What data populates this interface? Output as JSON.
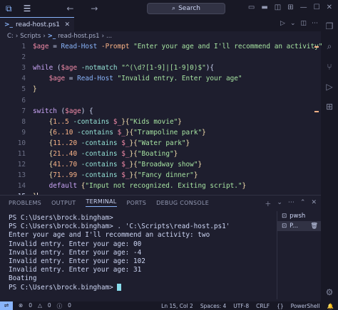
{
  "titlebar": {
    "search_placeholder": "Search"
  },
  "tab": {
    "filename": "read-host.ps1",
    "breadcrumb": [
      "C:",
      "Scripts",
      "read-host.ps1",
      "..."
    ]
  },
  "code": [
    {
      "n": "1",
      "tokens": [
        [
          "var",
          "$age"
        ],
        [
          "pl",
          " = "
        ],
        [
          "cmd",
          "Read-Host"
        ],
        [
          "par",
          " -Prompt "
        ],
        [
          "str",
          "\"Enter your age and I'll recommend an activity\""
        ]
      ]
    },
    {
      "n": "2",
      "tokens": []
    },
    {
      "n": "3",
      "tokens": [
        [
          "kw",
          "while"
        ],
        [
          "pl",
          " ("
        ],
        [
          "var",
          "$age"
        ],
        [
          "op",
          " -notmatch "
        ],
        [
          "str",
          "\"^(\\d?[1-9]|[1-9]0)$\""
        ],
        [
          "pl",
          "){"
        ]
      ]
    },
    {
      "n": "4",
      "tokens": [
        [
          "pl",
          "    "
        ],
        [
          "var",
          "$age"
        ],
        [
          "pl",
          " = "
        ],
        [
          "cmd",
          "Read-Host"
        ],
        [
          "str",
          " \"Invalid entry. Enter your age\""
        ]
      ]
    },
    {
      "n": "5",
      "tokens": [
        [
          "br",
          "}"
        ]
      ]
    },
    {
      "n": "6",
      "tokens": []
    },
    {
      "n": "7",
      "tokens": [
        [
          "kw",
          "switch"
        ],
        [
          "pl",
          " ("
        ],
        [
          "var",
          "$age"
        ],
        [
          "pl",
          ") {"
        ]
      ]
    },
    {
      "n": "8",
      "tokens": [
        [
          "pl",
          "    "
        ],
        [
          "br",
          "{"
        ],
        [
          "par",
          "1..5"
        ],
        [
          "op",
          " -contains "
        ],
        [
          "var",
          "$_"
        ],
        [
          "br",
          "}"
        ],
        [
          "br",
          "{"
        ],
        [
          "str",
          "\"Kids movie\""
        ],
        [
          "br",
          "}"
        ]
      ]
    },
    {
      "n": "9",
      "tokens": [
        [
          "pl",
          "    "
        ],
        [
          "br",
          "{"
        ],
        [
          "par",
          "6..10"
        ],
        [
          "op",
          " -contains "
        ],
        [
          "var",
          "$_"
        ],
        [
          "br",
          "}"
        ],
        [
          "br",
          "{"
        ],
        [
          "str",
          "\"Trampoline park\""
        ],
        [
          "br",
          "}"
        ]
      ]
    },
    {
      "n": "10",
      "tokens": [
        [
          "pl",
          "    "
        ],
        [
          "br",
          "{"
        ],
        [
          "par",
          "11..20"
        ],
        [
          "op",
          " -contains "
        ],
        [
          "var",
          "$_"
        ],
        [
          "br",
          "}"
        ],
        [
          "br",
          "{"
        ],
        [
          "str",
          "\"Water park\""
        ],
        [
          "br",
          "}"
        ]
      ]
    },
    {
      "n": "11",
      "tokens": [
        [
          "pl",
          "    "
        ],
        [
          "br",
          "{"
        ],
        [
          "par",
          "21..40"
        ],
        [
          "op",
          " -contains "
        ],
        [
          "var",
          "$_"
        ],
        [
          "br",
          "}"
        ],
        [
          "br",
          "{"
        ],
        [
          "str",
          "\"Boating\""
        ],
        [
          "br",
          "}"
        ]
      ]
    },
    {
      "n": "12",
      "tokens": [
        [
          "pl",
          "    "
        ],
        [
          "br",
          "{"
        ],
        [
          "par",
          "41..70"
        ],
        [
          "op",
          " -contains "
        ],
        [
          "var",
          "$_"
        ],
        [
          "br",
          "}"
        ],
        [
          "br",
          "{"
        ],
        [
          "str",
          "\"Broadway show\""
        ],
        [
          "br",
          "}"
        ]
      ]
    },
    {
      "n": "13",
      "tokens": [
        [
          "pl",
          "    "
        ],
        [
          "br",
          "{"
        ],
        [
          "par",
          "71..99"
        ],
        [
          "op",
          " -contains "
        ],
        [
          "var",
          "$_"
        ],
        [
          "br",
          "}"
        ],
        [
          "br",
          "{"
        ],
        [
          "str",
          "\"Fancy dinner\""
        ],
        [
          "br",
          "}"
        ]
      ]
    },
    {
      "n": "14",
      "tokens": [
        [
          "pl",
          "    "
        ],
        [
          "kw",
          "default"
        ],
        [
          "pl",
          " "
        ],
        [
          "br",
          "{"
        ],
        [
          "str",
          "\"Input not recognized. Exiting script.\""
        ],
        [
          "br",
          "}"
        ]
      ]
    },
    {
      "n": "15",
      "tokens": [
        [
          "br",
          "}"
        ]
      ]
    }
  ],
  "panel": {
    "tabs": [
      "PROBLEMS",
      "OUTPUT",
      "TERMINAL",
      "PORTS",
      "DEBUG CONSOLE"
    ],
    "active_tab": "TERMINAL",
    "terminal_lines": [
      "PS C:\\Users\\brock.bingham>",
      "PS C:\\Users\\brock.bingham> . 'C:\\Scripts\\read-host.ps1'",
      "Enter your age and I'll recommend an activity: two",
      "Invalid entry. Enter your age: 00",
      "Invalid entry. Enter your age: -4",
      "Invalid entry. Enter your age: 102",
      "Invalid entry. Enter your age: 31",
      "Boating",
      "PS C:\\Users\\brock.bingham> "
    ],
    "terminals": [
      "pwsh",
      "P..."
    ]
  },
  "status": {
    "errors": "0",
    "warnings": "0",
    "info": "0",
    "position": "Ln 15, Col 2",
    "spaces": "Spaces: 4",
    "encoding": "UTF-8",
    "eol": "CRLF",
    "language": "PowerShell"
  }
}
